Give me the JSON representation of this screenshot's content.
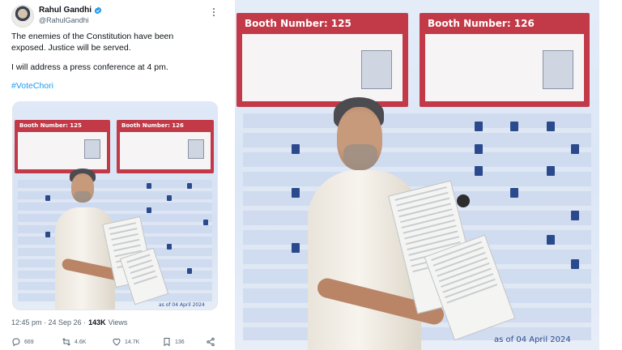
{
  "tweet": {
    "author_name": "Rahul Gandhi",
    "handle": "@RahulGandhi",
    "text_line1": "The enemies of the Constitution have been",
    "text_line2": "exposed. Justice will be served.",
    "text_line3": "I will address a press conference at 4 pm.",
    "hashtag": "#VoteChori",
    "timestamp": "12:45 pm · 24 Sep 26 · ",
    "views_count": "143K",
    "views_label": "Views",
    "actions": {
      "replies": "669",
      "reposts": "4.6K",
      "likes": "14.7K",
      "bookmarks": "136"
    }
  },
  "media_small": {
    "booth_left": "Booth Number: 125",
    "booth_right": "Booth Number: 126",
    "date_text": "as of 04 April 2024"
  },
  "photo_large": {
    "booth_left": "Booth Number: 125",
    "booth_right": "Booth Number: 126",
    "date_text": "as of 04 April 2024"
  },
  "colors": {
    "link": "#1d9bf0",
    "secondary_text": "#536471",
    "booth_red": "#c23a48"
  }
}
